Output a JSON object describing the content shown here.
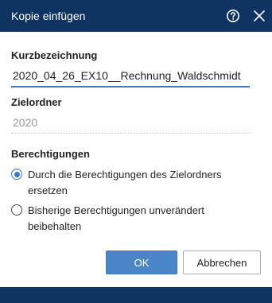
{
  "dialog": {
    "title": "Kopie einfügen",
    "help_icon": "help-circle-icon",
    "close_icon": "close-icon"
  },
  "form": {
    "shortname_label": "Kurzbezeichnung",
    "shortname_value": "2020_04_26_EX10__Rechnung_Waldschmidt",
    "target_folder_label": "Zielordner",
    "target_folder_value": "2020",
    "permissions_label": "Berechtigungen",
    "permission_options": [
      {
        "label_line1": "Durch die Berechtigungen des Zielordners",
        "label_line2": "ersetzen",
        "selected": true
      },
      {
        "label_line1": "Bisherige Berechtigungen unverändert",
        "label_line2": "beibehalten",
        "selected": false
      }
    ]
  },
  "buttons": {
    "ok_label": "OK",
    "cancel_label": "Abbrechen"
  },
  "colors": {
    "titlebar": "#0f3461",
    "accent": "#3b77c5",
    "ok_button": "#4a86c7"
  }
}
